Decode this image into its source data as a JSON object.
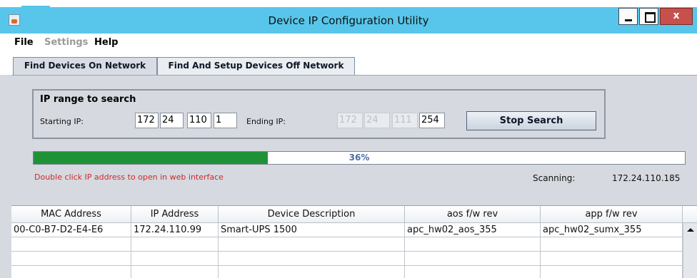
{
  "window": {
    "title": "Device IP Configuration Utility",
    "close_label": "x",
    "accent_color": "#58c6ea"
  },
  "menu": {
    "file": "File",
    "settings": "Settings",
    "help": "Help"
  },
  "tabs": [
    {
      "label": "Find Devices On Network",
      "selected": true
    },
    {
      "label": "Find And Setup Devices Off Network",
      "selected": false
    }
  ],
  "ip_range": {
    "title": "IP range to search",
    "starting_label": "Starting IP:",
    "starting_ip": [
      "172",
      "24",
      "110",
      "1"
    ],
    "ending_label": "Ending IP:",
    "ending_ip": [
      "172",
      "24",
      "111",
      "254"
    ],
    "stop_button": "Stop Search"
  },
  "progress": {
    "percent": 36,
    "text": "36%",
    "fill_color": "#1f9237"
  },
  "hint": "Double click IP address to open in web interface",
  "scanning": {
    "label": "Scanning:",
    "ip": "172.24.110.185"
  },
  "table": {
    "columns": [
      "MAC Address",
      "IP Address",
      "Device Description",
      "aos f/w rev",
      "app f/w rev"
    ],
    "rows": [
      [
        "00-C0-B7-D2-E4-E6",
        "172.24.110.99",
        "Smart-UPS 1500",
        "apc_hw02_aos_355",
        "apc_hw02_sumx_355"
      ],
      [
        "",
        "",
        "",
        "",
        ""
      ],
      [
        "",
        "",
        "",
        "",
        ""
      ],
      [
        "",
        "",
        "",
        "",
        ""
      ]
    ]
  }
}
